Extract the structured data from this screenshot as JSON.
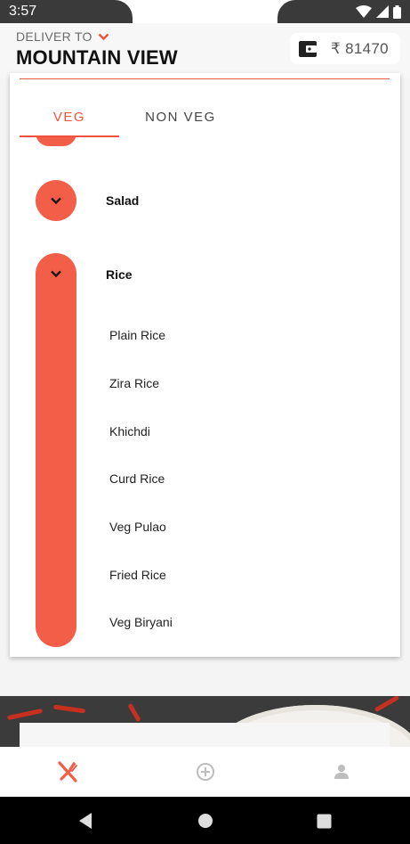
{
  "status_bar": {
    "time": "3:57"
  },
  "header": {
    "deliver_label": "DELIVER TO",
    "location": "MOUNTAIN VIEW",
    "wallet": {
      "currency": "₹",
      "amount": "81470"
    }
  },
  "tabs": [
    {
      "label": "VEG",
      "active": true
    },
    {
      "label": "NON VEG",
      "active": false
    }
  ],
  "categories": [
    {
      "name": "Salad",
      "expanded": false
    },
    {
      "name": "Rice",
      "expanded": true,
      "items": [
        "Plain Rice",
        "Zira Rice",
        "Khichdi",
        "Curd Rice",
        "Veg Pulao",
        "Fried Rice",
        "Veg Biryani"
      ]
    }
  ],
  "bottom_nav": [
    {
      "icon": "fork-knife-icon",
      "active": true
    },
    {
      "icon": "add-circle-icon",
      "active": false
    },
    {
      "icon": "person-icon",
      "active": false
    }
  ],
  "colors": {
    "accent": "#f25e47",
    "inactive": "#bdbdbd"
  }
}
